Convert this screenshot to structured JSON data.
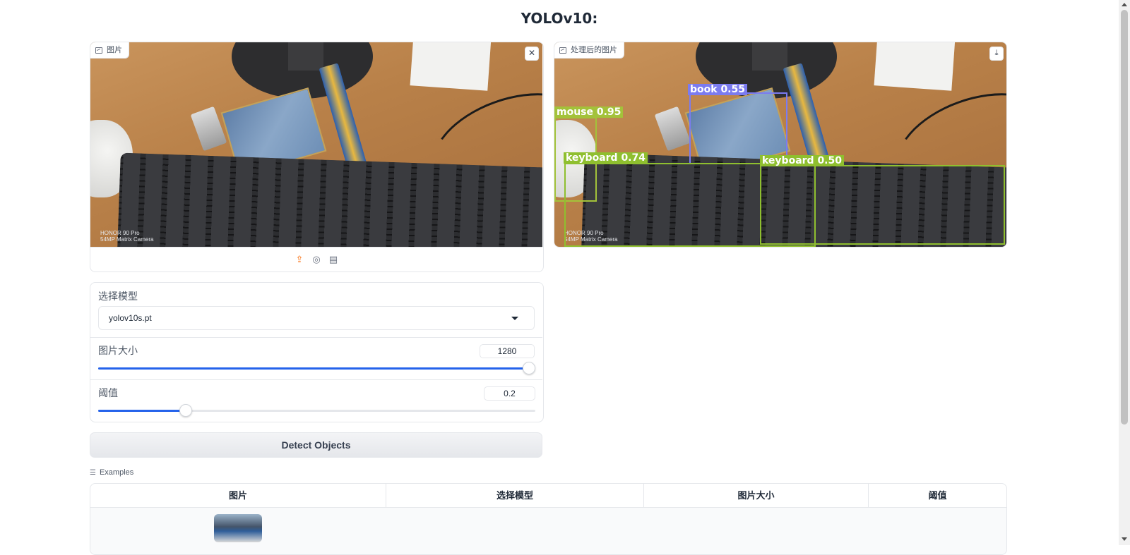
{
  "page": {
    "title": "YOLOv10:"
  },
  "input_image": {
    "label": "图片",
    "camera_text_line1": "HONOR 90 Pro",
    "camera_text_line2": "54MP Matrix Camera",
    "close_icon": "close-icon",
    "source_icons": [
      "upload-icon",
      "webcam-icon",
      "clipboard-icon"
    ]
  },
  "output_image": {
    "label": "处理后的图片",
    "download_icon": "download-icon",
    "detections": [
      {
        "label": "book 0.55",
        "color": "#7b7bf0"
      },
      {
        "label": "mouse 0.95",
        "color": "#a3c23a"
      },
      {
        "label": "keyboard 0.74",
        "color": "#8fbf2f"
      },
      {
        "label": "keyboard 0.50",
        "color": "#8fbf2f"
      }
    ]
  },
  "controls": {
    "model_label": "选择模型",
    "model_value": "yolov10s.pt",
    "image_size_label": "图片大小",
    "image_size_value": "1280",
    "image_size_fraction": 1.0,
    "threshold_label": "阈值",
    "threshold_value": "0.2",
    "threshold_fraction": 0.2
  },
  "detect_button": {
    "label": "Detect Objects"
  },
  "examples": {
    "label": "Examples",
    "columns": [
      "图片",
      "选择模型",
      "图片大小",
      "阈值"
    ]
  },
  "colors": {
    "accent": "#2563eb",
    "upload_active": "#f97316"
  }
}
